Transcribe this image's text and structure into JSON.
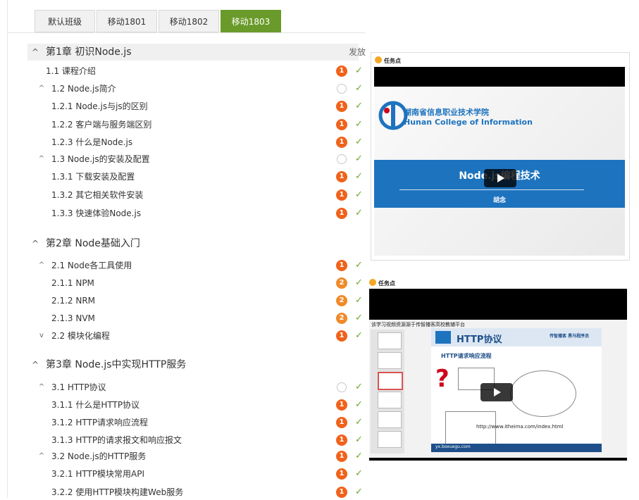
{
  "tabs": [
    "默认班级",
    "移动1801",
    "移动1802",
    "移动1803"
  ],
  "active_tab": "移动1803",
  "publish_label": "发放",
  "chapters": [
    {
      "title": "第1章  初识Node.js"
    },
    {
      "title": "第2章  Node基础入门"
    },
    {
      "title": "第3章  Node.js中实现HTTP服务"
    }
  ],
  "rows": [
    {
      "text": "1.1  课程介绍",
      "badge": "1"
    },
    {
      "text": "1.2  Node.js简介",
      "badge": ""
    },
    {
      "text": "1.2.1 Node.js与js的区别",
      "badge": "1"
    },
    {
      "text": "1.2.2 客户端与服务端区别",
      "badge": "1"
    },
    {
      "text": "1.2.3 什么是Node.js",
      "badge": "1"
    },
    {
      "text": "1.3  Node.js的安装及配置",
      "badge": ""
    },
    {
      "text": "1.3.1 下载安装及配置",
      "badge": "1"
    },
    {
      "text": "1.3.2 其它相关软件安装",
      "badge": "1"
    },
    {
      "text": "1.3.3 快速体验Node.js",
      "badge": "1"
    },
    {
      "text": "2.1  Node各工具使用",
      "badge": "1"
    },
    {
      "text": "2.1.1 NPM",
      "badge": "2"
    },
    {
      "text": "2.1.2 NRM",
      "badge": "2"
    },
    {
      "text": "2.1.3 NVM",
      "badge": "2"
    },
    {
      "text": "2.2  模块化编程",
      "badge": "1"
    },
    {
      "text": "3.1  HTTP协议",
      "badge": ""
    },
    {
      "text": "3.1.1 什么是HTTP协议",
      "badge": "1"
    },
    {
      "text": "3.1.2 HTTP请求响应流程",
      "badge": "1"
    },
    {
      "text": "3.1.3 HTTP的请求报文和响应报文",
      "badge": "1"
    },
    {
      "text": "3.2  Node.js的HTTP服务",
      "badge": "1"
    },
    {
      "text": "3.2.1 HTTP模块常用API",
      "badge": "1"
    },
    {
      "text": "3.2.2 使用HTTP模块构建Web服务",
      "badge": "1"
    }
  ],
  "video1": {
    "task_label": "任务点",
    "college_cn": "湖南省信息职业技术学院",
    "college_en": "Hunan College of Information",
    "course_title": "Node.js编程技术",
    "author": "胡念"
  },
  "video2": {
    "task_label": "任务点",
    "source_note": "该学习视频资源源于传智播客高校教辅平台",
    "slide_title": "HTTP协议",
    "brand": "传智播客 黑马程序员",
    "bullet": "HTTP请求响应流程",
    "url": "http://www.itheima.com/index.html",
    "footer": "yx.boxuegu.com"
  },
  "colors": {
    "accent": "#6a9b2a",
    "badge_red": "#f0621a",
    "check": "#6aa52a",
    "banner": "#1e73be"
  }
}
